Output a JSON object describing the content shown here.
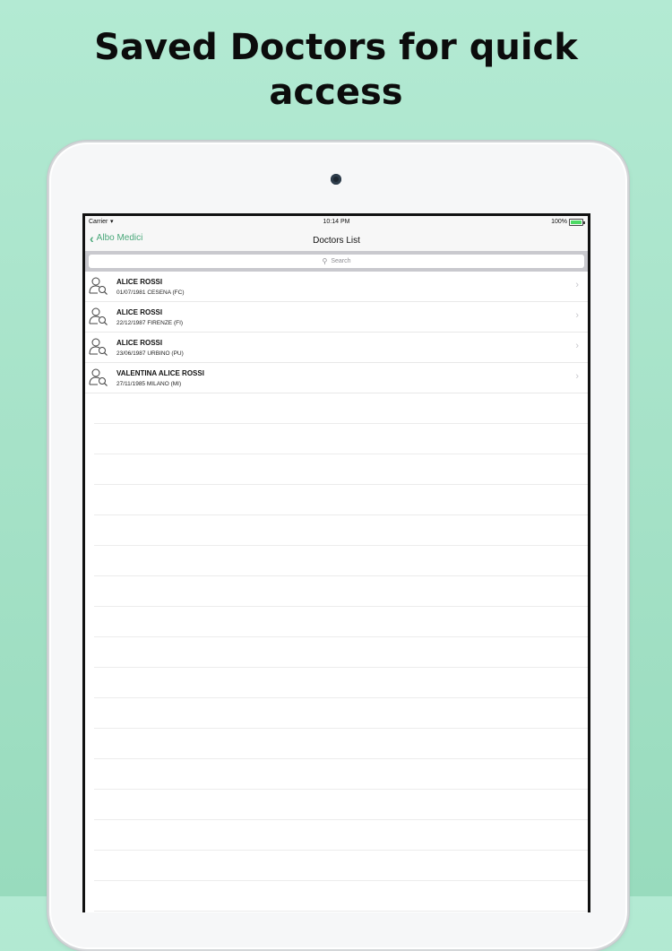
{
  "promo": {
    "headline_line1": "Saved Doctors for quick",
    "headline_line2": "access"
  },
  "status_bar": {
    "carrier": "Carrier",
    "time": "10:14 PM",
    "battery": "100%"
  },
  "nav": {
    "back_label": "Albo Medici",
    "title": "Doctors List"
  },
  "search": {
    "placeholder": "Search"
  },
  "doctors": [
    {
      "name": "ALICE ROSSI",
      "detail": "01/07/1981  CESENA (FC)"
    },
    {
      "name": "ALICE ROSSI",
      "detail": "22/12/1987  FIRENZE (FI)"
    },
    {
      "name": "ALICE ROSSI",
      "detail": "23/06/1987  URBINO (PU)"
    },
    {
      "name": "VALENTINA ALICE ROSSI",
      "detail": "27/11/1985  MILANO (MI)"
    }
  ],
  "colors": {
    "accent": "#4aa87a",
    "background": "#a6e2c8",
    "battery": "#4cd964"
  },
  "icons": [
    "back-chevron-icon",
    "search-icon",
    "doctor-search-icon",
    "chevron-right-icon",
    "wifi-icon",
    "battery-icon"
  ]
}
